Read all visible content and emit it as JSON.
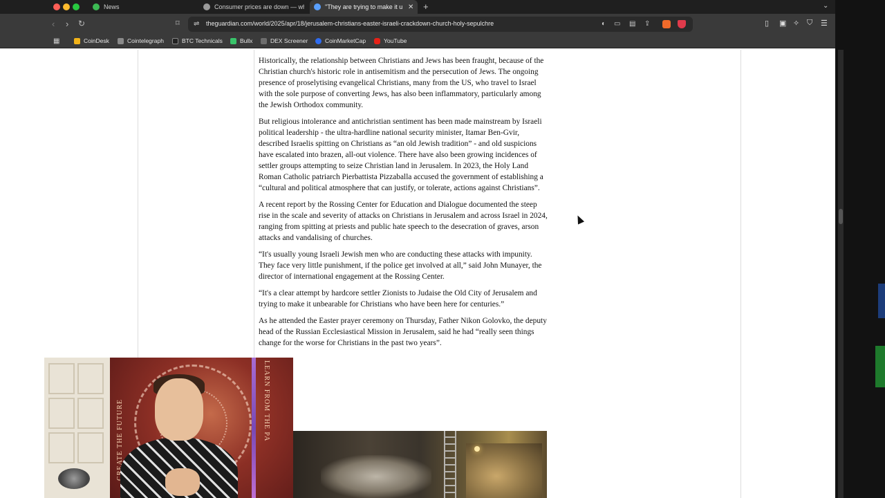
{
  "browser": {
    "tabs": [
      {
        "label": "News",
        "active": false,
        "favicon_color": "#3cba54"
      },
      {
        "label": "Consumer prices are down — wh",
        "active": false,
        "favicon_color": "#9a9a9a"
      },
      {
        "label": "\"They are trying to make it ur",
        "active": true,
        "favicon_color": "#5aa0ff",
        "close": "✕"
      }
    ],
    "new_tab": "+",
    "url": "theguardian.com/world/2025/apr/18/jerusalem-christians-easter-israeli-crackdown-church-holy-sepulchre",
    "bookmarks": [
      {
        "label": "CoinDesk",
        "color": "#f2b319"
      },
      {
        "label": "Cointelegraph",
        "color": "#8a8a8a"
      },
      {
        "label": "BTC Technicals",
        "color": "#222222"
      },
      {
        "label": "Bullx",
        "color": "#39c46a"
      },
      {
        "label": "DEX Screener",
        "color": "#6d6d6d"
      },
      {
        "label": "CoinMarketCap",
        "color": "#2f6cf0"
      },
      {
        "label": "YouTube",
        "color": "#e62117"
      }
    ]
  },
  "article": {
    "paragraphs": [
      "Historically, the relationship between Christians and Jews has been fraught, because of the Christian church's historic role in antisemitism and the persecution of Jews. The ongoing presence of proselytising evangelical Christians, many from the US, who travel to Israel with the sole purpose of converting Jews, has also been inflammatory, particularly among the Jewish Orthodox community.",
      "But religious intolerance and antichristian sentiment has been made mainstream by Israeli political leadership - the ultra-hardline national security minister, Itamar Ben-Gvir, described Israelis spitting on Christians as “an old Jewish tradition” - and old suspicions have escalated into brazen, all-out violence. There have also been growing incidences of settler groups attempting to seize Christian land in Jerusalem. In 2023, the Holy Land Roman Catholic patriarch Pierbattista Pizzaballa accused the government of establishing a “cultural and political atmosphere that can justify, or tolerate, actions against Christians”.",
      "A recent report by the Rossing Center for Education and Dialogue documented the steep rise in the scale and severity of attacks on Christians in Jerusalem and across Israel in 2024, ranging from spitting at priests and public hate speech to the desecration of graves, arson attacks and vandalising of churches.",
      "“It's usually young Israeli Jewish men who are conducting these attacks with impunity. They face very little punishment, if the police get involved at all,” said John Munayer, the director of international engagement at the Rossing Center.",
      "“It's a clear attempt by hardcore settler Zionists to Judaise the Old City of Jerusalem and trying to make it unbearable for Christians who have been here for centuries.”",
      "As he attended the Easter prayer ceremony on Thursday, Father Nikon Golovko, the deputy head of the Russian Ecclesiastical Mission in Jerusalem, said he had “really seen things change for the worse for Christians in the past two years”."
    ]
  },
  "webcam": {
    "tapestry_text_1": "LEARN FROM THE PA",
    "tapestry_text_2": "CREATE THE FUTURE"
  }
}
